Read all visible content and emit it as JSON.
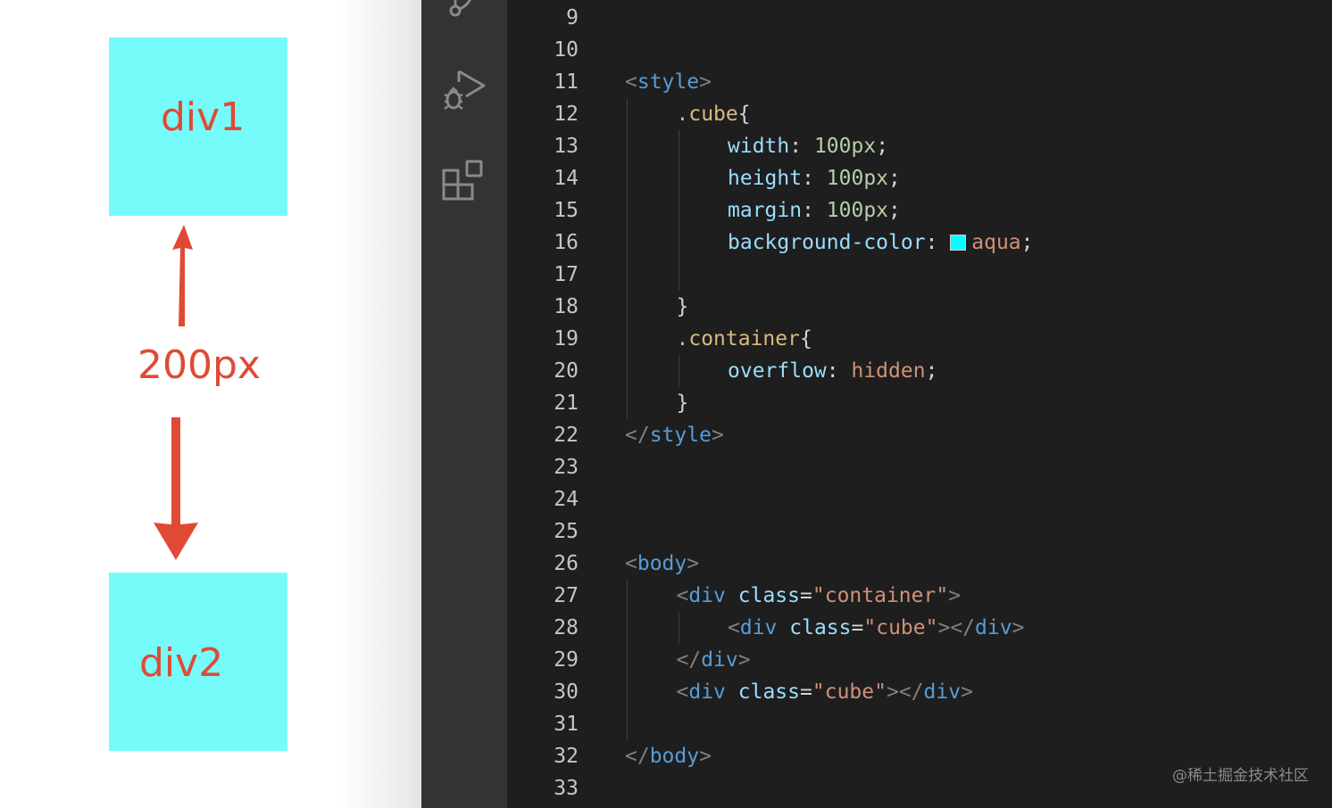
{
  "preview": {
    "div1_label": "div1",
    "div2_label": "div2",
    "gap_label": "200px",
    "cube_color": "#76FBFB",
    "annotation_color": "#E04A35"
  },
  "activity_icons": [
    "source-control-icon",
    "run-debug-icon",
    "extensions-icon"
  ],
  "editor": {
    "lines": [
      {
        "n": "9",
        "tokens": []
      },
      {
        "n": "10",
        "tokens": []
      },
      {
        "n": "11",
        "tokens": [
          {
            "t": "<",
            "c": "t-punct"
          },
          {
            "t": "style",
            "c": "t-tag"
          },
          {
            "t": ">",
            "c": "t-punct"
          }
        ]
      },
      {
        "n": "12",
        "tokens": [
          {
            "t": ".cube",
            "c": "t-sel"
          },
          {
            "t": "{",
            "c": "t-text"
          }
        ]
      },
      {
        "n": "13",
        "tokens": [
          {
            "t": "width",
            "c": "t-prop"
          },
          {
            "t": ": ",
            "c": "t-text"
          },
          {
            "t": "100px",
            "c": "t-num"
          },
          {
            "t": ";",
            "c": "t-text"
          }
        ]
      },
      {
        "n": "14",
        "tokens": [
          {
            "t": "height",
            "c": "t-prop"
          },
          {
            "t": ": ",
            "c": "t-text"
          },
          {
            "t": "100px",
            "c": "t-num"
          },
          {
            "t": ";",
            "c": "t-text"
          }
        ]
      },
      {
        "n": "15",
        "tokens": [
          {
            "t": "margin",
            "c": "t-prop"
          },
          {
            "t": ": ",
            "c": "t-text"
          },
          {
            "t": "100px",
            "c": "t-num"
          },
          {
            "t": ";",
            "c": "t-text"
          }
        ]
      },
      {
        "n": "16",
        "tokens": [
          {
            "t": "background-color",
            "c": "t-prop"
          },
          {
            "t": ": ",
            "c": "t-text"
          },
          {
            "swatch": "#00FFFF"
          },
          {
            "t": "aqua",
            "c": "t-str"
          },
          {
            "t": ";",
            "c": "t-text"
          }
        ]
      },
      {
        "n": "17",
        "tokens": []
      },
      {
        "n": "18",
        "tokens": [
          {
            "t": "}",
            "c": "t-text"
          }
        ]
      },
      {
        "n": "19",
        "tokens": [
          {
            "t": ".container",
            "c": "t-sel"
          },
          {
            "t": "{",
            "c": "t-text"
          }
        ]
      },
      {
        "n": "20",
        "tokens": [
          {
            "t": "overflow",
            "c": "t-prop"
          },
          {
            "t": ": ",
            "c": "t-text"
          },
          {
            "t": "hidden",
            "c": "t-str"
          },
          {
            "t": ";",
            "c": "t-text"
          }
        ]
      },
      {
        "n": "21",
        "tokens": [
          {
            "t": "}",
            "c": "t-text"
          }
        ]
      },
      {
        "n": "22",
        "tokens": [
          {
            "t": "</",
            "c": "t-punct"
          },
          {
            "t": "style",
            "c": "t-tag"
          },
          {
            "t": ">",
            "c": "t-punct"
          }
        ]
      },
      {
        "n": "23",
        "tokens": []
      },
      {
        "n": "24",
        "tokens": []
      },
      {
        "n": "25",
        "tokens": []
      },
      {
        "n": "26",
        "tokens": [
          {
            "t": "<",
            "c": "t-punct"
          },
          {
            "t": "body",
            "c": "t-tag"
          },
          {
            "t": ">",
            "c": "t-punct"
          }
        ]
      },
      {
        "n": "27",
        "tokens": [
          {
            "t": "<",
            "c": "t-punct"
          },
          {
            "t": "div",
            "c": "t-tag"
          },
          {
            "t": " ",
            "c": "t-text"
          },
          {
            "t": "class",
            "c": "t-prop"
          },
          {
            "t": "=",
            "c": "t-text"
          },
          {
            "t": "\"container\"",
            "c": "t-str"
          },
          {
            "t": ">",
            "c": "t-punct"
          }
        ]
      },
      {
        "n": "28",
        "tokens": [
          {
            "t": "<",
            "c": "t-punct"
          },
          {
            "t": "div",
            "c": "t-tag"
          },
          {
            "t": " ",
            "c": "t-text"
          },
          {
            "t": "class",
            "c": "t-prop"
          },
          {
            "t": "=",
            "c": "t-text"
          },
          {
            "t": "\"cube\"",
            "c": "t-str"
          },
          {
            "t": "></",
            "c": "t-punct"
          },
          {
            "t": "div",
            "c": "t-tag"
          },
          {
            "t": ">",
            "c": "t-punct"
          }
        ]
      },
      {
        "n": "29",
        "tokens": [
          {
            "t": "</",
            "c": "t-punct"
          },
          {
            "t": "div",
            "c": "t-tag"
          },
          {
            "t": ">",
            "c": "t-punct"
          }
        ]
      },
      {
        "n": "30",
        "tokens": [
          {
            "t": "<",
            "c": "t-punct"
          },
          {
            "t": "div",
            "c": "t-tag"
          },
          {
            "t": " ",
            "c": "t-text"
          },
          {
            "t": "class",
            "c": "t-prop"
          },
          {
            "t": "=",
            "c": "t-text"
          },
          {
            "t": "\"cube\"",
            "c": "t-str"
          },
          {
            "t": "></",
            "c": "t-punct"
          },
          {
            "t": "div",
            "c": "t-tag"
          },
          {
            "t": ">",
            "c": "t-punct"
          }
        ]
      },
      {
        "n": "31",
        "tokens": []
      },
      {
        "n": "32",
        "tokens": [
          {
            "t": "</",
            "c": "t-punct"
          },
          {
            "t": "body",
            "c": "t-tag"
          },
          {
            "t": ">",
            "c": "t-punct"
          }
        ]
      },
      {
        "n": "33",
        "tokens": []
      }
    ]
  },
  "watermark": "@稀土掘金技术社区"
}
